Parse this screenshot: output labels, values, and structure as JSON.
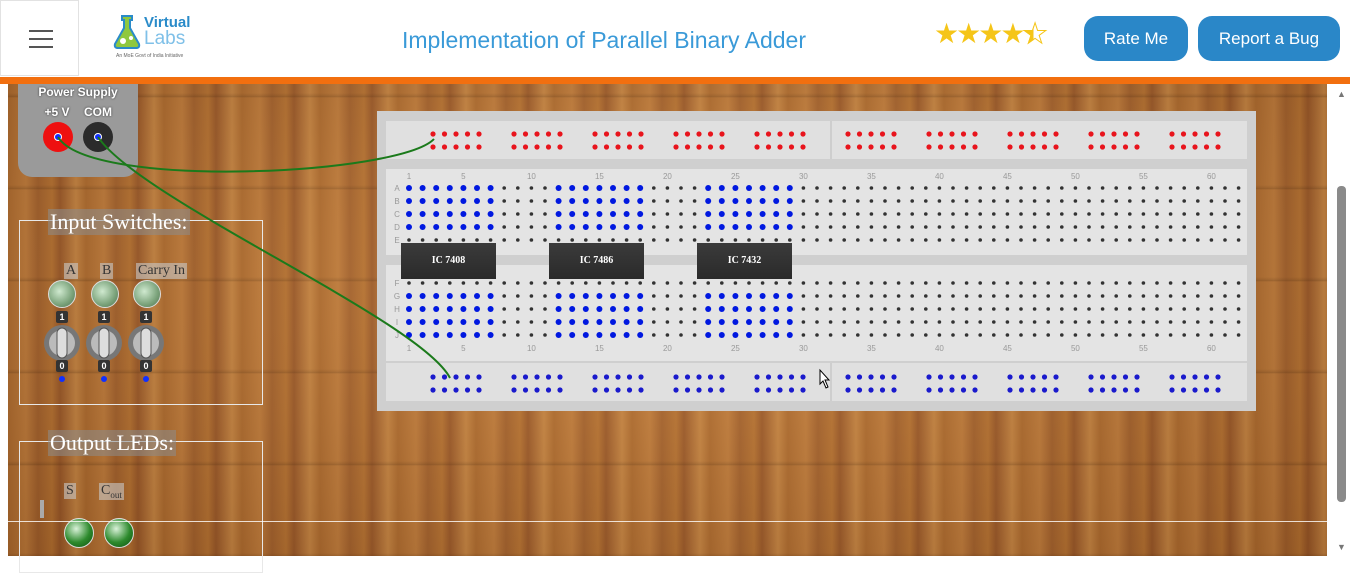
{
  "header": {
    "logo_line1": "Virtual",
    "logo_line2": "Labs",
    "logo_sub": "An MoE Govt of India Initiative",
    "title": "Implementation of Parallel Binary Adder",
    "rating": 4.5,
    "rate_label": "Rate Me",
    "bug_label": "Report a Bug"
  },
  "power": {
    "title": "Power Supply",
    "plus_label": "+5 V",
    "com_label": "COM"
  },
  "inputs": {
    "title": "Input Switches:",
    "switches": [
      {
        "label": "A",
        "state": "0"
      },
      {
        "label": "B",
        "state": "0"
      },
      {
        "label": "Carry In",
        "state": "0"
      }
    ],
    "on": "1",
    "off": "0"
  },
  "outputs": {
    "title": "Output LEDs:",
    "leds": [
      {
        "label": "S"
      },
      {
        "label": "C",
        "sub": "out"
      }
    ]
  },
  "breadboard": {
    "column_numbers": [
      "1",
      "5",
      "10",
      "15",
      "20",
      "25",
      "30",
      "35",
      "40",
      "45",
      "50",
      "55",
      "60"
    ],
    "row_letters_top": [
      "A",
      "B",
      "C",
      "D",
      "E"
    ],
    "row_letters_bottom": [
      "F",
      "G",
      "H",
      "I",
      "J"
    ],
    "ics": [
      "IC 7408",
      "IC 7486",
      "IC 7432"
    ],
    "colors": {
      "plus_rail": "#e8141c",
      "ground_rail": "#1a1acc",
      "used_hole": "#0018e0",
      "hole": "#333333",
      "wire": "#1b7a1b"
    }
  }
}
